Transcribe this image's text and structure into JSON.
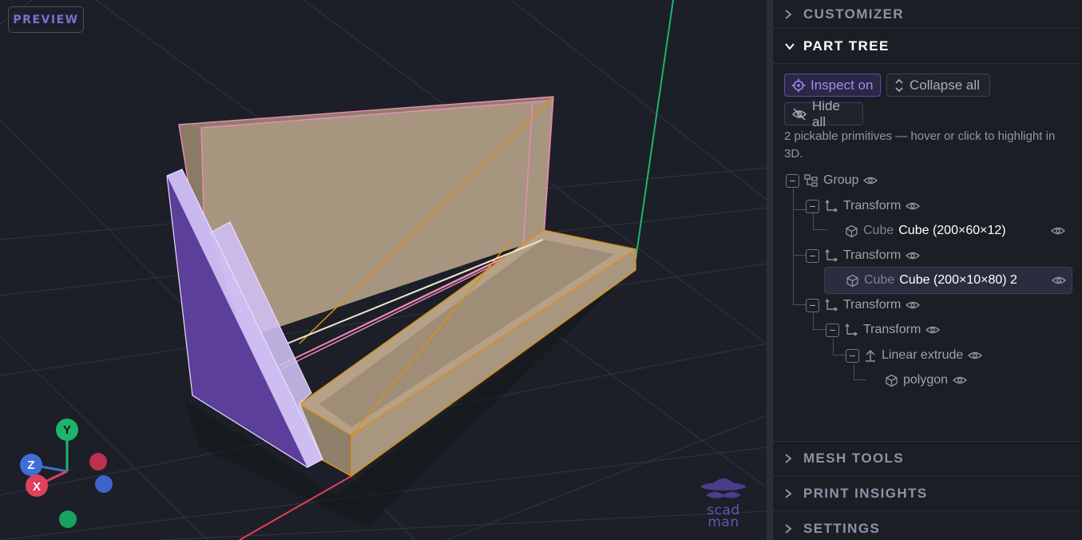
{
  "viewport": {
    "badge": "PREVIEW",
    "logo_line1": "scad",
    "logo_line2": "man",
    "gizmo": {
      "y_label": "Y",
      "z_label": "Z",
      "x_label": "X"
    }
  },
  "panel": {
    "sections": {
      "customizer": "CUSTOMIZER",
      "part_tree": "PART TREE",
      "mesh_tools": "MESH TOOLS",
      "print_insights": "PRINT INSIGHTS",
      "settings": "SETTINGS"
    },
    "toolbar": {
      "inspect_label": "Inspect on",
      "collapse_label": "Collapse all",
      "hide_label": "Hide all"
    },
    "hint": "2 pickable primitives — hover or click to highlight in 3D.",
    "tree": {
      "group": "Group",
      "transform1": "Transform",
      "cube1_type": "Cube",
      "cube1_name": "Cube (200×60×12)",
      "transform2": "Transform",
      "cube2_type": "Cube",
      "cube2_name": "Cube (200×10×80) 2",
      "transform3": "Transform",
      "transform4": "Transform",
      "linear_extrude": "Linear extrude",
      "polygon": "polygon"
    }
  },
  "colors": {
    "accent": "#7c6fd6",
    "axis_x": "#e0405a",
    "axis_y": "#1db46b",
    "axis_z": "#3f6fd6",
    "highlight_pink": "#f08ab8",
    "highlight_orange": "#d8901a",
    "part_tan": "#a89580",
    "part_purple": "#5b3f9a"
  }
}
